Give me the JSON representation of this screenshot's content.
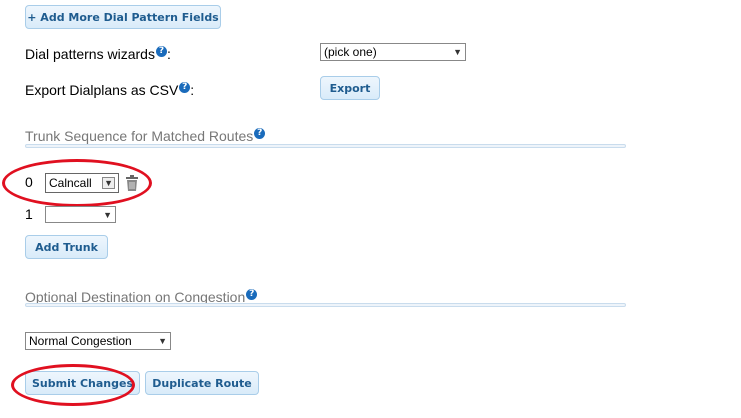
{
  "buttons": {
    "add_more": "+ Add More Dial Pattern Fields",
    "export": "Export",
    "add_trunk": "Add Trunk",
    "submit": "Submit Changes",
    "duplicate": "Duplicate Route"
  },
  "labels": {
    "wizards": "Dial patterns wizards",
    "export_csv": "Export Dialplans as CSV",
    "colon": ":"
  },
  "selects": {
    "wizard_value": "(pick one)",
    "congestion_value": "Normal Congestion"
  },
  "sections": {
    "trunk_sequence": "Trunk Sequence for Matched Routes",
    "optional_destination": "Optional Destination on Congestion"
  },
  "trunks": [
    {
      "index": "0",
      "value": "Calncall"
    },
    {
      "index": "1",
      "value": ""
    }
  ],
  "icons": {
    "help": "?",
    "arrow": "▼",
    "delete": "trash-icon"
  },
  "colors": {
    "accent": "#1f5c8f",
    "annotation": "#e01020"
  }
}
